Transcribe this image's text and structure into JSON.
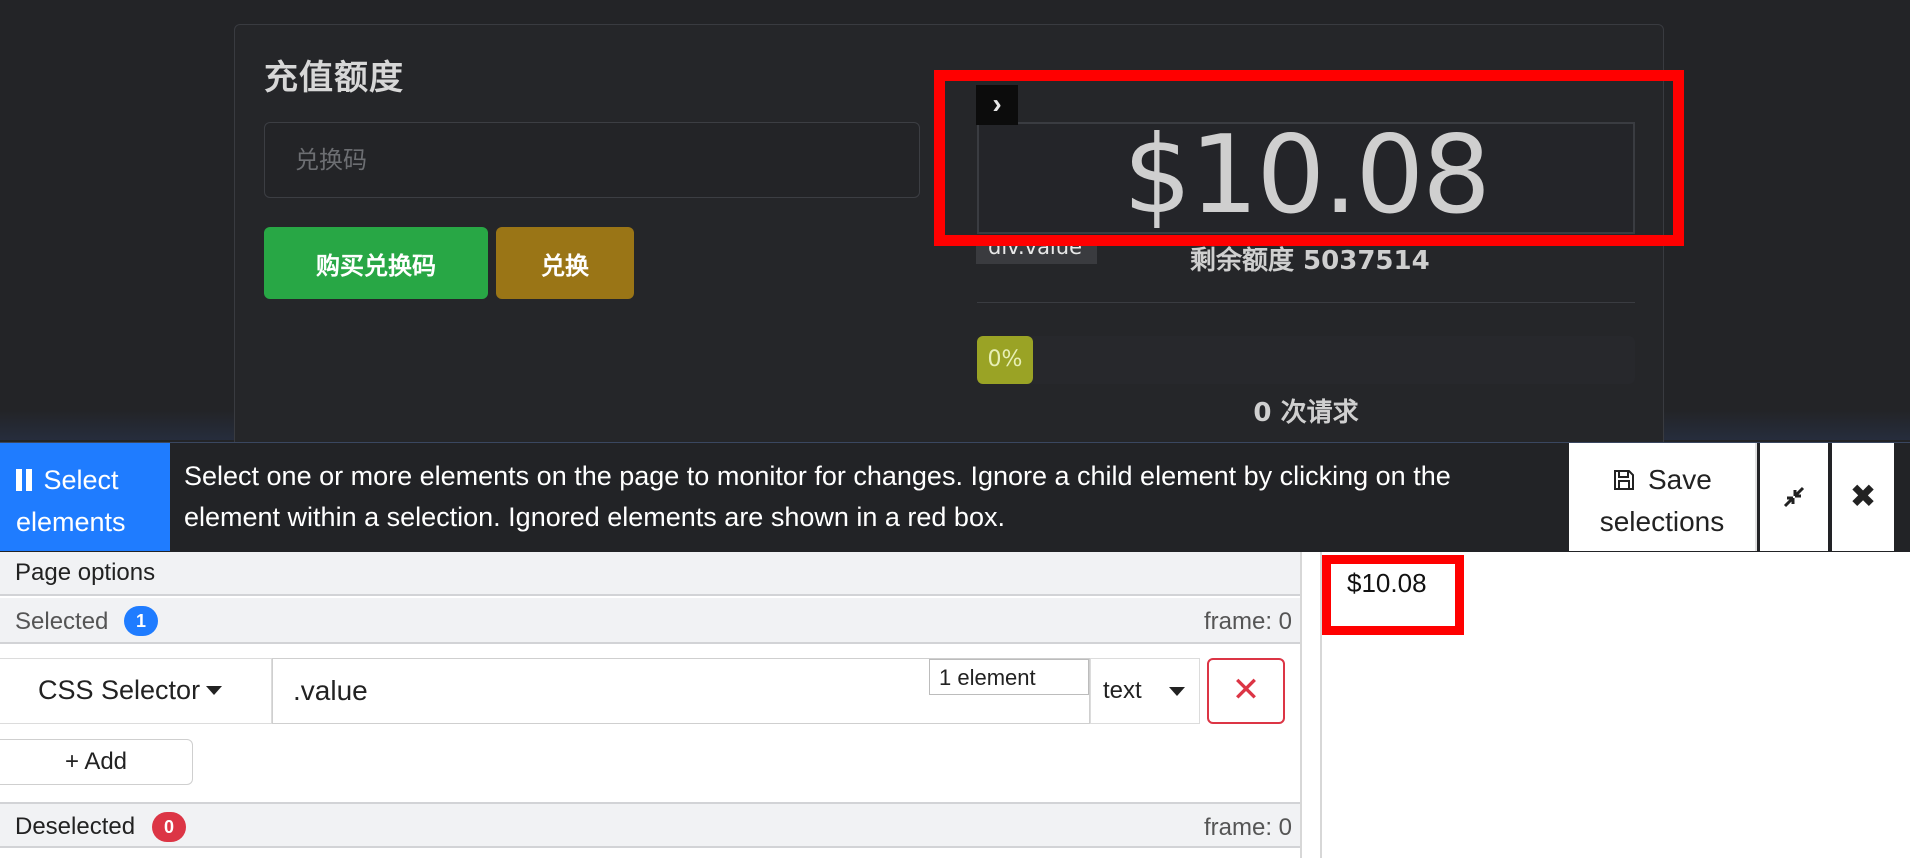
{
  "page": {
    "card_title": "充值额度",
    "redeem_placeholder": "兑换码",
    "buy_button": "购买兑换码",
    "redeem_button": "兑换",
    "balance_value": "$10.08",
    "remaining_label": "剩余额度 5037514",
    "progress_percent": "0%",
    "progress_fraction": 0,
    "requests_label": "0 次请求",
    "inspector_tag": "div.value",
    "inspector_arrow_icon": "chevron-right-icon"
  },
  "toolbar": {
    "select_label": "Select elements",
    "message": "Select one or more elements on the page to monitor for changes. Ignore a child element by clicking on the element within a selection. Ignored elements are shown in a red box.",
    "save_label": "Save selections",
    "icons": [
      "pause-icon",
      "floppy-disk-icon",
      "collapse-icon",
      "close-icon"
    ]
  },
  "panel": {
    "page_options": "Page options",
    "selected_label": "Selected",
    "selected_count": "1",
    "selected_frame": "frame: 0",
    "selector_type": "CSS Selector",
    "selector_value": ".value",
    "match_count": "1 element",
    "value_type": "text",
    "add_button": "+ Add",
    "deselected_label": "Deselected",
    "deselected_count": "0",
    "deselected_frame": "frame: 0"
  },
  "preview": {
    "value": "$10.08"
  },
  "colors": {
    "primary": "#1f7cff",
    "success": "#28a745",
    "warning": "#9a7516",
    "danger": "#dc3545",
    "highlight": "#ff0000",
    "progress": "#9aa325",
    "dark_bg": "#232427"
  }
}
